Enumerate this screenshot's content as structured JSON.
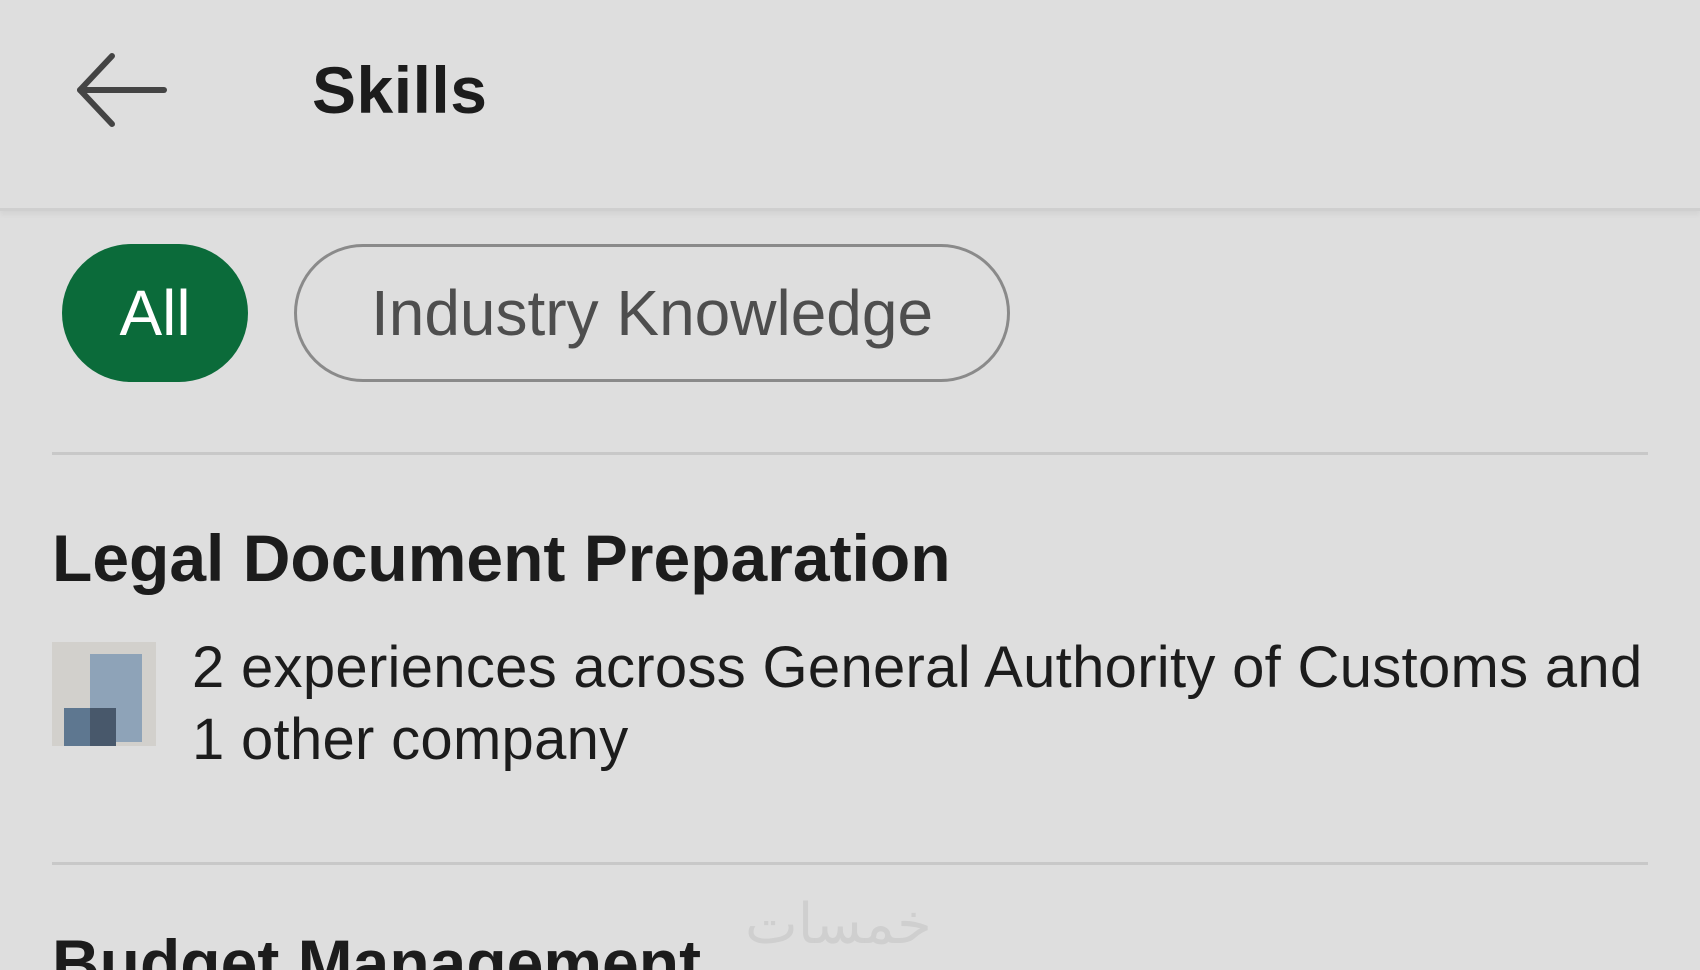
{
  "header": {
    "title": "Skills",
    "back_icon": "arrow-left-icon"
  },
  "filters": {
    "chips": [
      {
        "label": "All",
        "selected": true,
        "color": "#0b6b3a"
      },
      {
        "label": "Industry Knowledge",
        "selected": false
      }
    ]
  },
  "skills": [
    {
      "name": "Legal Document Preparation",
      "detail": "2 experiences across General Authority of Customs and 1 other company",
      "logo_icon": "company-logo-icon"
    },
    {
      "name": "Budget Management"
    }
  ],
  "watermark": "خمسات"
}
